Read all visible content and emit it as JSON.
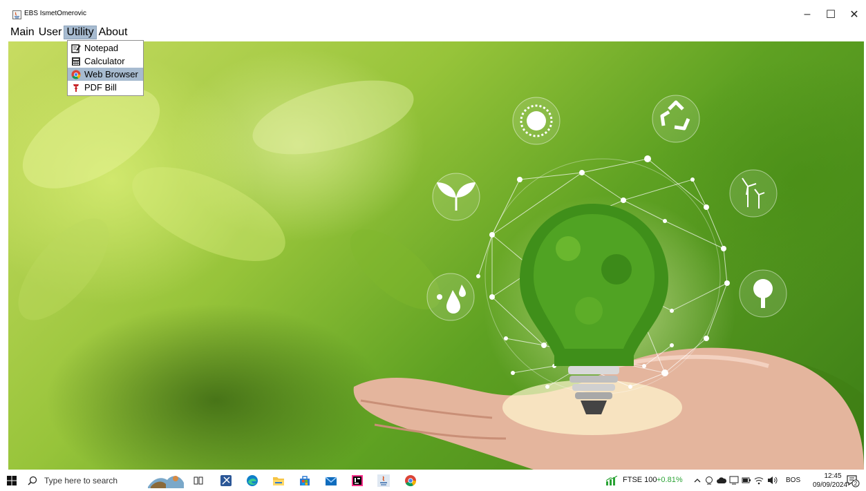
{
  "window": {
    "title": "EBS IsmetOmerovic",
    "minimize_glyph": "–",
    "maximize_glyph": "☐",
    "close_glyph": "✕"
  },
  "menubar": {
    "items": [
      "Main",
      "User",
      "Utility",
      "About"
    ],
    "open_item": "Utility"
  },
  "dropdown": {
    "items": [
      {
        "label": "Notepad",
        "icon": "notepad-icon"
      },
      {
        "label": "Calculator",
        "icon": "calculator-icon"
      },
      {
        "label": "Web Browser",
        "icon": "chrome-icon",
        "highlighted": true
      },
      {
        "label": "PDF Bill",
        "icon": "pdf-icon"
      }
    ]
  },
  "background": {
    "icons": [
      "sun-icon",
      "recycle-icon",
      "sprout-icon",
      "wind-turbine-icon",
      "water-drops-icon",
      "tree-icon"
    ]
  },
  "taskbar": {
    "search_placeholder": "Type here to search",
    "ticker_name": "FTSE 100",
    "ticker_value": "+0.81%",
    "language": "BOS",
    "time": "12:45",
    "date": "09/09/2024",
    "notification_count": "2"
  },
  "colors": {
    "menu_highlight": "#a7bbd0",
    "ticker_positive": "#2aa335"
  }
}
